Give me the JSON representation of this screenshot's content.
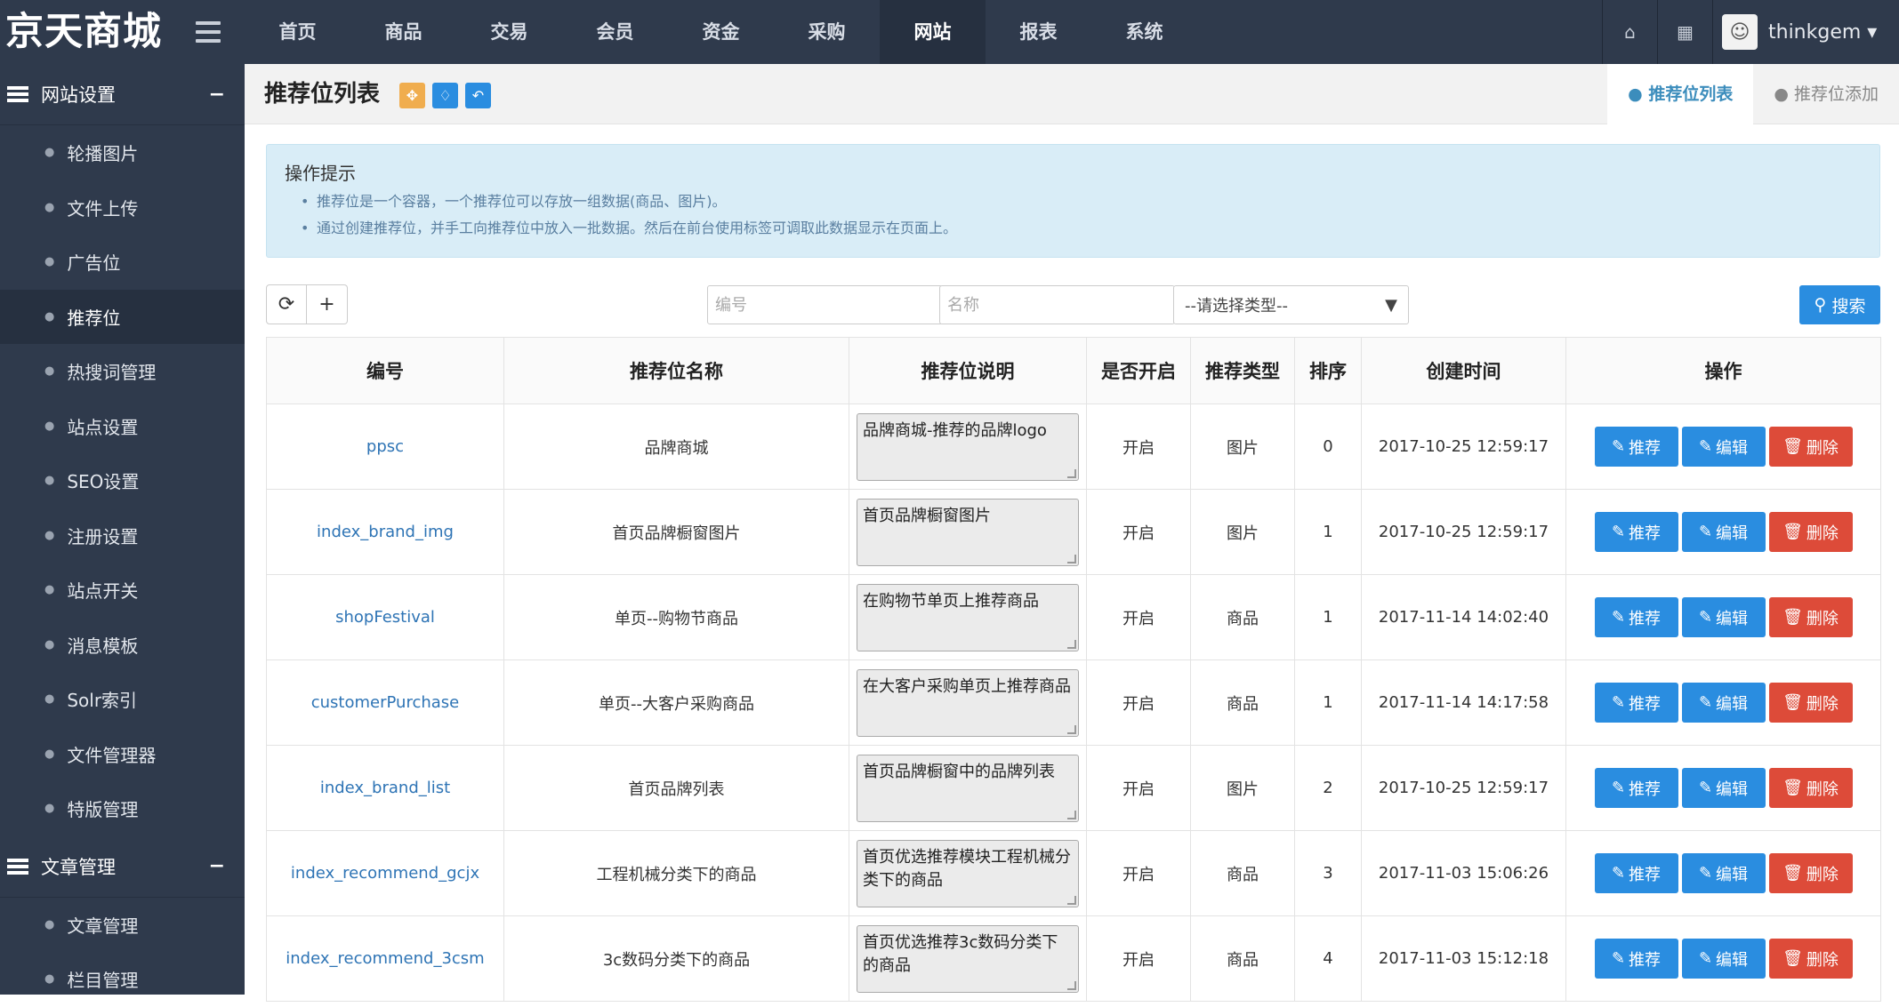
{
  "app": {
    "logo": "京天商城"
  },
  "topnav": [
    "首页",
    "商品",
    "交易",
    "会员",
    "资金",
    "采购",
    "网站",
    "报表",
    "系统"
  ],
  "user": {
    "name": "thinkgem ▾"
  },
  "sidebar": {
    "group1": "网站设置",
    "items1": [
      "轮播图片",
      "文件上传",
      "广告位",
      "推荐位",
      "热搜词管理",
      "站点设置",
      "SEO设置",
      "注册设置",
      "站点开关",
      "消息模板",
      "Solr索引",
      "文件管理器",
      "特版管理"
    ],
    "group2": "文章管理",
    "items2": [
      "文章管理",
      "栏目管理"
    ]
  },
  "page": {
    "title": "推荐位列表",
    "tab_list": "推荐位列表",
    "tab_add": "推荐位添加"
  },
  "tips": {
    "title": "操作提示",
    "lines": [
      "推荐位是一个容器，一个推荐位可以存放一组数据(商品、图片)。",
      "通过创建推荐位，并手工向推荐位中放入一批数据。然后在前台使用标签可调取此数据显示在页面上。"
    ]
  },
  "filters": {
    "code_placeholder": "编号",
    "name_placeholder": "名称",
    "type_selected": "--请选择类型--",
    "search_label": "搜索"
  },
  "table": {
    "headers": [
      "编号",
      "推荐位名称",
      "推荐位说明",
      "是否开启",
      "推荐类型",
      "排序",
      "创建时间",
      "操作"
    ],
    "rows": [
      {
        "code": "ppsc",
        "name": "品牌商城",
        "desc": "品牌商城-推荐的品牌logo",
        "enabled": "开启",
        "type": "图片",
        "order": "0",
        "created": "2017-10-25 12:59:17"
      },
      {
        "code": "index_brand_img",
        "name": "首页品牌橱窗图片",
        "desc": "首页品牌橱窗图片",
        "enabled": "开启",
        "type": "图片",
        "order": "1",
        "created": "2017-10-25 12:59:17"
      },
      {
        "code": "shopFestival",
        "name": "单页--购物节商品",
        "desc": "在购物节单页上推荐商品",
        "enabled": "开启",
        "type": "商品",
        "order": "1",
        "created": "2017-11-14 14:02:40"
      },
      {
        "code": "customerPurchase",
        "name": "单页--大客户采购商品",
        "desc": "在大客户采购单页上推荐商品",
        "enabled": "开启",
        "type": "商品",
        "order": "1",
        "created": "2017-11-14 14:17:58"
      },
      {
        "code": "index_brand_list",
        "name": "首页品牌列表",
        "desc": "首页品牌橱窗中的品牌列表",
        "enabled": "开启",
        "type": "图片",
        "order": "2",
        "created": "2017-10-25 12:59:17"
      },
      {
        "code": "index_recommend_gcjx",
        "name": "工程机械分类下的商品",
        "desc": "首页优选推荐模块工程机械分类下的商品",
        "enabled": "开启",
        "type": "商品",
        "order": "3",
        "created": "2017-11-03 15:06:26"
      },
      {
        "code": "index_recommend_3csm",
        "name": "3c数码分类下的商品",
        "desc": "首页优选推荐3c数码分类下的商品",
        "enabled": "开启",
        "type": "商品",
        "order": "4",
        "created": "2017-11-03 15:12:18"
      }
    ],
    "btn_recommend": "推荐",
    "btn_edit": "编辑",
    "btn_delete": "删除"
  },
  "colors": {
    "topbar": "#2f3a4c",
    "primary": "#2a8de0",
    "danger": "#dd4b39",
    "link": "#2e74b5"
  }
}
